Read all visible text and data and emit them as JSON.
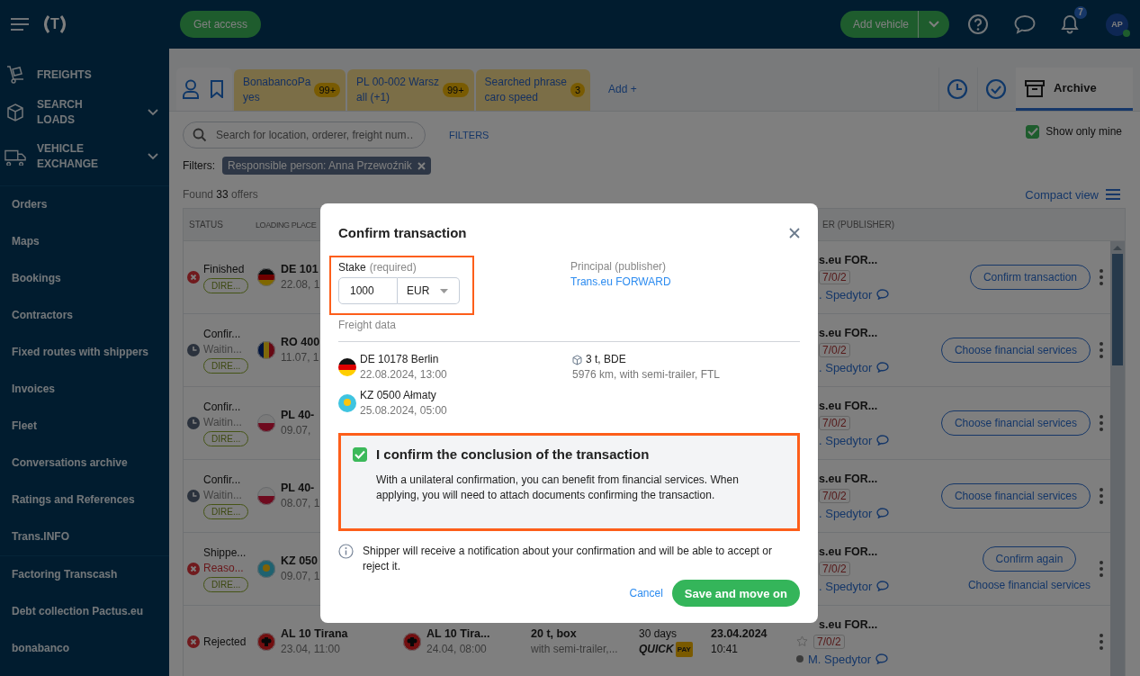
{
  "topbar": {
    "logo": "T",
    "get_access": "Get access",
    "add_vehicle": "Add vehicle",
    "notifications": "7",
    "avatar": "AP",
    "online": true
  },
  "sidebar": {
    "sections": [
      {
        "label": "FREIGHTS",
        "expandable": false
      },
      {
        "label": "SEARCH LOADS",
        "expandable": true
      },
      {
        "label": "VEHICLE EXCHANGE",
        "expandable": true
      }
    ],
    "items": [
      "Orders",
      "Maps",
      "Bookings",
      "Contractors",
      "Fixed routes with shippers",
      "Invoices",
      "Fleet",
      "Conversations archive",
      "Ratings and References",
      "Trans.INFO"
    ],
    "extra_items": [
      "Factoring Transcash",
      "Debt collection Pactus.eu",
      "bonabanco"
    ]
  },
  "tabs": {
    "saved": [
      {
        "line1": "BonabancoPa",
        "line2": "yes",
        "count": "99+",
        "selected": false
      },
      {
        "line1": "PL 00-002 Warsz",
        "line2": "all (+1)",
        "count": "99+",
        "selected": false
      },
      {
        "line1": "Searched phrase",
        "line2": "caro speed",
        "count": "3",
        "selected": false
      }
    ],
    "add": "Add +",
    "archive": {
      "label": "Archive",
      "selected": true
    }
  },
  "search": {
    "placeholder": "Search for location, orderer, freight num…",
    "filters_link": "FILTERS"
  },
  "show_only_mine": {
    "label": "Show only mine",
    "checked": true
  },
  "filters": {
    "label": "Filters:",
    "chips": [
      "Responsible person: Anna Przewoźnik"
    ]
  },
  "found": "Found **33** offers",
  "compact_view": "Compact view",
  "table": {
    "columns": [
      "STATUS",
      "LOADING PLACE",
      "ER (PUBLISHER)"
    ],
    "rows": [
      {
        "status": {
          "kind": "rejected",
          "lines": [
            {
              "text": "Finished",
              "kind": "title"
            }
          ],
          "badge": "DIRE..."
        },
        "loading": {
          "place": "DE 101",
          "time": "22.08, 1"
        },
        "publisher": {
          "name": "s.eu FOR...",
          "rating": "7/0/2",
          "contact": ". Spedytor"
        },
        "actions": [
          {
            "label": "Confirm transaction",
            "kind": "outline"
          }
        ]
      },
      {
        "status": {
          "kind": "pending",
          "lines": [
            {
              "text": "Confir...",
              "kind": "title"
            },
            {
              "text": "Waitin...",
              "kind": "note"
            }
          ],
          "badge": "DIRE..."
        },
        "loading": {
          "place": "RO 400",
          "time": "11.07, 1"
        },
        "publisher": {
          "name": "s.eu FOR...",
          "rating": "7/0/2",
          "contact": ". Spedytor"
        },
        "actions": [
          {
            "label": "Choose financial services",
            "kind": "outline"
          }
        ]
      },
      {
        "status": {
          "kind": "pending",
          "lines": [
            {
              "text": "Confir...",
              "kind": "title"
            },
            {
              "text": "Waitin...",
              "kind": "note"
            }
          ],
          "badge": "DIRE..."
        },
        "loading": {
          "place": "PL 40-",
          "time": "09.07,"
        },
        "publisher": {
          "name": "s.eu FOR...",
          "rating": "7/0/2",
          "contact": ". Spedytor"
        },
        "actions": [
          {
            "label": "Choose financial services",
            "kind": "outline"
          }
        ]
      },
      {
        "status": {
          "kind": "pending",
          "lines": [
            {
              "text": "Confir...",
              "kind": "title"
            },
            {
              "text": "Waitin...",
              "kind": "note"
            }
          ],
          "badge": "DIRE..."
        },
        "loading": {
          "place": "PL 40-",
          "time": "08.07, 1"
        },
        "publisher": {
          "name": "s.eu FOR...",
          "rating": "7/0/2",
          "contact": ". Spedytor"
        },
        "actions": [
          {
            "label": "Choose financial services",
            "kind": "outline"
          }
        ]
      },
      {
        "status": {
          "kind": "rejected",
          "lines": [
            {
              "text": "Shippe...",
              "kind": "title"
            },
            {
              "text": "Reaso...",
              "kind": "alert"
            }
          ],
          "badge": "DIRE..."
        },
        "loading": {
          "place": "KZ 050",
          "time": "09.07, 1"
        },
        "publisher": {
          "name": "s.eu FOR...",
          "rating": "7/0/2",
          "contact": ". Spedytor"
        },
        "actions": [
          {
            "label": "Confirm again",
            "kind": "outline"
          },
          {
            "label": "Choose financial services",
            "kind": "link"
          }
        ]
      },
      {
        "status": {
          "kind": "rejected",
          "lines": [
            {
              "text": "Rejected",
              "kind": "title"
            }
          ]
        },
        "loading": {
          "place": "AL 10 Tirana",
          "time": "23.04, 11:00"
        },
        "unloading": {
          "place": "AL 10 Tira...",
          "time": "24.04, 08:00"
        },
        "cargo": {
          "main": "20 t, box",
          "detail": "with semi-trailer,..."
        },
        "payment": {
          "term": "30 days",
          "logo": "QUICK",
          "logo_badge": "PAY"
        },
        "date": {
          "day": "23.04.2024",
          "time": "10:41"
        },
        "publisher": {
          "starred": false,
          "name": "s.eu FOR...",
          "rating": "7/0/2",
          "contact": "M. Spedytor"
        },
        "actions": []
      }
    ]
  },
  "modal": {
    "title": "Confirm transaction",
    "stake": {
      "label": "Stake",
      "hint": "(required)",
      "value": "1000",
      "currency": "EUR",
      "highlighted": true
    },
    "principal": {
      "label": "Principal (publisher)",
      "link": "Trans.eu FORWARD"
    },
    "freight_label": "Freight data",
    "stops": [
      {
        "place": "DE 10178 Berlin",
        "time": "22.08.2024, 13:00"
      },
      {
        "place": "KZ 0500 Ałmaty",
        "time": "25.08.2024, 05:00"
      }
    ],
    "cargo": {
      "main": "3 t, BDE",
      "detail": "5976 km, with semi-trailer, FTL"
    },
    "confirmation": {
      "checked": true,
      "highlighted": true,
      "title": "I confirm the conclusion of the transaction",
      "text": "With a unilateral confirmation, you can benefit from financial services. When applying, you will need to attach documents confirming the transaction."
    },
    "info": "Shipper will receive a notification about your confirmation and will be able to accept or reject it.",
    "cancel": "Cancel",
    "save": "Save and move on"
  }
}
